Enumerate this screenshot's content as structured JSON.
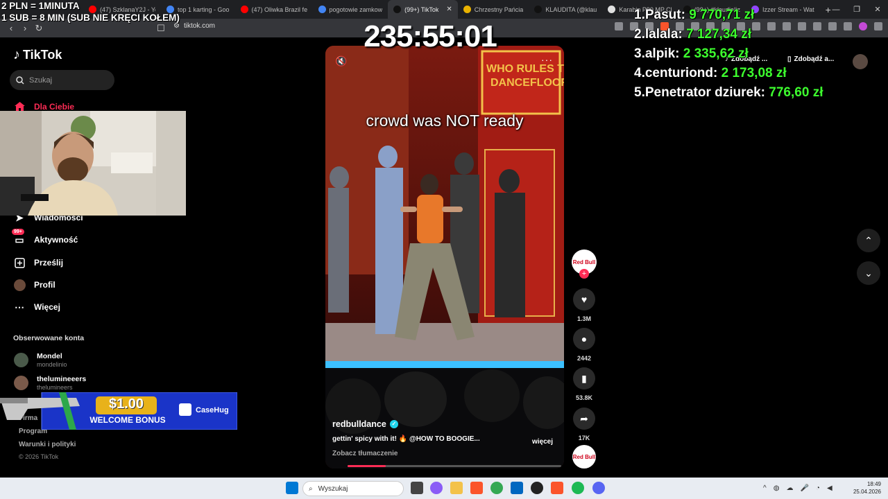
{
  "overlay": {
    "line1": "2 PLN = 1MINUTA",
    "line2": "1 SUB = 8 MIN (SUB NIE KRĘCI KOŁEM)",
    "timer": "235:55:01"
  },
  "browser": {
    "tabs": [
      {
        "label": "(47) SzklanaY2J - Yo",
        "color": "#ff0000"
      },
      {
        "label": "top 1 karting - Goo",
        "color": "#4285f4"
      },
      {
        "label": "(47) Oliwka Brazil fe",
        "color": "#ff0000"
      },
      {
        "label": "pogotowie zamkow",
        "color": "#4285f4"
      },
      {
        "label": "(99+) TikTok",
        "color": "#111111",
        "active": true
      },
      {
        "label": "Chrzestny Pańcia",
        "color": "#e9b200"
      },
      {
        "label": "KLAUDITA (@klau",
        "color": "#111111"
      },
      {
        "label": "Karabin P90 MP Cl",
        "color": "#e0e0e0"
      },
      {
        "label": "(99+) #klaudiaIiz",
        "color": "#111111"
      },
      {
        "label": "Izzer Stream - Wat",
        "color": "#9146ff"
      }
    ],
    "url": "tiktok.com",
    "new_tab": "+"
  },
  "sidebar": {
    "logo": "TikTok",
    "search_placeholder": "Szukaj",
    "items": [
      {
        "label": "Dla Ciebie",
        "icon": "home-icon"
      },
      {
        "label": "Wiadomości",
        "icon": "send-icon"
      },
      {
        "label": "Aktywność",
        "icon": "inbox-icon",
        "badge": "99+"
      },
      {
        "label": "Prześlij",
        "icon": "upload-icon"
      },
      {
        "label": "Profil",
        "icon": "profile-icon"
      },
      {
        "label": "Więcej",
        "icon": "more-icon"
      }
    ],
    "followed_header": "Obserwowane konta",
    "followed": [
      {
        "name": "Mondel",
        "handle": "mondelinio"
      },
      {
        "name": "thelumineeers",
        "handle": "thelumineers"
      }
    ],
    "footer": {
      "company": "Firma",
      "program": "Program",
      "terms": "Warunki i polityki",
      "copyright": "© 2026 TikTok"
    }
  },
  "ad": {
    "amount": "$1.00",
    "text": "WELCOME BONUS",
    "brand": "CaseHug"
  },
  "video": {
    "caption": "crowd was NOT ready",
    "username": "redbulldance",
    "description": "gettin' spicy with it! 🔥 @HOW TO BOOGIE...",
    "more": "więcej",
    "translate": "Zobacz tłumaczenie",
    "progress": 0.18,
    "sign": "WHO RULES THE DANCEFLOOR"
  },
  "actions": {
    "avatar_text": "Red Bull",
    "likes": "1.3M",
    "comments": "2442",
    "saves": "53.8K",
    "shares": "17K"
  },
  "leaderboard": [
    {
      "rank": "1.",
      "name": "Pasut:",
      "amount": "9 770,71 zł"
    },
    {
      "rank": "2.",
      "name": "lalala:",
      "amount": "7 127,34 zł"
    },
    {
      "rank": "3.",
      "name": "alpik:",
      "amount": "2 335,62 zł"
    },
    {
      "rank": "4.",
      "name": "centuriond:",
      "amount": "2 173,08 zł"
    },
    {
      "rank": "5.",
      "name": "Penetrator dziurek:",
      "amount": "776,60 zł"
    }
  ],
  "topright": {
    "get_app1": "Zdobądź ...",
    "get_app2": "Zdobądź a..."
  },
  "taskbar": {
    "search_placeholder": "Wyszukaj",
    "time": "18:49",
    "date": "25.04.2026"
  }
}
